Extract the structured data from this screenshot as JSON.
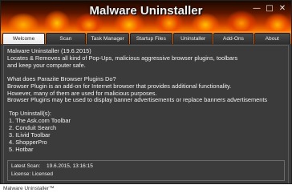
{
  "window": {
    "title": "Malware Uninstaller",
    "controls": {
      "minimize": "—",
      "maximize": "□",
      "close": "✕"
    }
  },
  "tabs": [
    {
      "label": "Welcome",
      "active": true
    },
    {
      "label": "Scan",
      "active": false
    },
    {
      "label": "Task Manager",
      "active": false
    },
    {
      "label": "Startup Files",
      "active": false
    },
    {
      "label": "Uninstaller",
      "active": false
    },
    {
      "label": "Add-Ons",
      "active": false
    },
    {
      "label": "About",
      "active": false
    }
  ],
  "content": {
    "intro": [
      "Malware Uninstaller (19.6.2015)",
      "Locates & Removes all kind of Pop-Ups, malicious aggressive browser plugins, toolbars",
      "and keep your computer safe."
    ],
    "parazite": [
      "What does Parazite Browser Plugins Do?",
      "Browser Plugin is an add-on for Internet browser that provides additional functionality.",
      "However, many of them are used for malicious purposes.",
      "Browser Plugins may be used to display banner advertisements or replace banners advertisements"
    ],
    "top_title": "Top Uninstall(s):",
    "top_items": [
      "1. The Ask.com Toolbar",
      "2. Conduit Search",
      "3. ILivid Toolbar",
      "4. ShopperPro",
      "5. Hotbar"
    ],
    "info": {
      "latest_scan_label": "Latest Scan:",
      "latest_scan_value": "19.6.2015, 13:16:15",
      "license_label": "License: Licensed"
    }
  },
  "statusbar": {
    "text": "Malware Uninstaller™"
  }
}
